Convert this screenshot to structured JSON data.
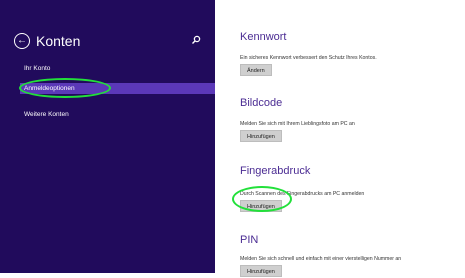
{
  "sidebar": {
    "title": "Konten",
    "items": [
      {
        "label": "Ihr Konto"
      },
      {
        "label": "Anmeldeoptionen"
      },
      {
        "label": "Weitere Konten"
      }
    ]
  },
  "sections": [
    {
      "title": "Kennwort",
      "desc": "Ein sicheres Kennwort verbessert den Schutz Ihres Kontos.",
      "button": "Ändern"
    },
    {
      "title": "Bildcode",
      "desc": "Melden Sie sich mit Ihrem Lieblingsfoto am PC an",
      "button": "Hinzufügen"
    },
    {
      "title": "Fingerabdruck",
      "desc": "Durch Scannen des Fingerabdrucks am PC anmelden",
      "button": "Hinzufügen"
    },
    {
      "title": "PIN",
      "desc": "Melden Sie sich schnell und einfach mit einer vierstelligen Nummer an",
      "button": "Hinzufügen"
    }
  ],
  "colors": {
    "sidebar_bg": "#210b5c",
    "active_item": "#5b38b8",
    "title": "#4b2c93",
    "highlight_ring": "#22e03a"
  }
}
